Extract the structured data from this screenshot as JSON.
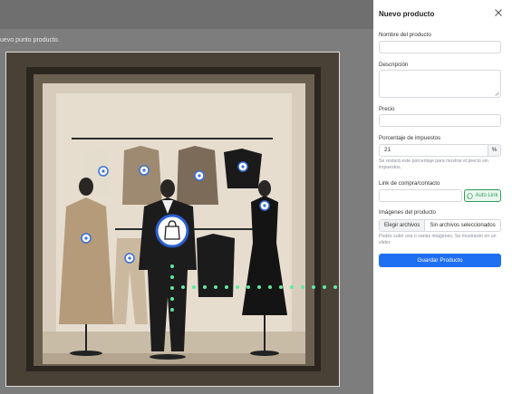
{
  "page": {
    "hint_text": "uevo punto producto."
  },
  "panel": {
    "title": "Nuevo producto",
    "name_label": "Nombre del producto",
    "name_value": "",
    "description_label": "Descripción",
    "description_value": "",
    "price_label": "Precio",
    "price_value": "",
    "tax_label": "Porcentaje de impuestos",
    "tax_value": "21",
    "tax_suffix": "%",
    "tax_help": "Se restará este porcentaje para mostrar el precio sin impuestos.",
    "link_label": "Link de compra/contacto",
    "link_value": "",
    "autolink_label": "Auto Link",
    "images_label": "Imágenes del producto",
    "file_button_label": "Elegir archivos",
    "file_status": "Sin archivos seleccionados",
    "images_help": "Podés subir una o varias imágenes. Se mostrarán en un slider.",
    "save_label": "Guardar Producto"
  },
  "colors": {
    "accent": "#1f6ff2",
    "whatsapp": "#2f9e5a",
    "hotspot": "#3b6fd8",
    "connector": "#63e8a0"
  }
}
